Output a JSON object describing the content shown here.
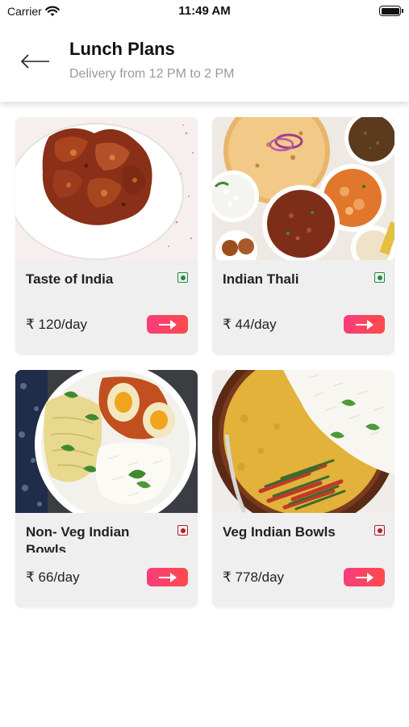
{
  "status_bar": {
    "carrier": "Carrier",
    "time": "11:49 AM",
    "wifi_icon": "wifi-icon",
    "battery_icon": "battery-full-icon"
  },
  "header": {
    "back_icon": "arrow-left-icon",
    "title": "Lunch Plans",
    "subtitle": "Delivery from 12 PM to 2 PM"
  },
  "colors": {
    "veg": "#1e8f3a",
    "non_veg": "#b3202a",
    "button_gradient_start": "#f73d7c",
    "button_gradient_end": "#ff4a4a",
    "card_bg": "#efefef"
  },
  "plans": [
    {
      "title": "Taste of India",
      "price": "₹ 120/day",
      "diet": "veg",
      "image": "chicken-curry-plate"
    },
    {
      "title": "Indian Thali",
      "price": "₹ 44/day",
      "diet": "veg",
      "image": "indian-thali-spread"
    },
    {
      "title": "Non- Veg Indian Bowls",
      "price": "₹ 66/day",
      "diet": "non-veg",
      "image": "egg-curry-rice-plate"
    },
    {
      "title": "Veg Indian Bowls",
      "price": "₹ 778/day",
      "diet": "non-veg",
      "image": "dal-rice-bowl"
    }
  ]
}
